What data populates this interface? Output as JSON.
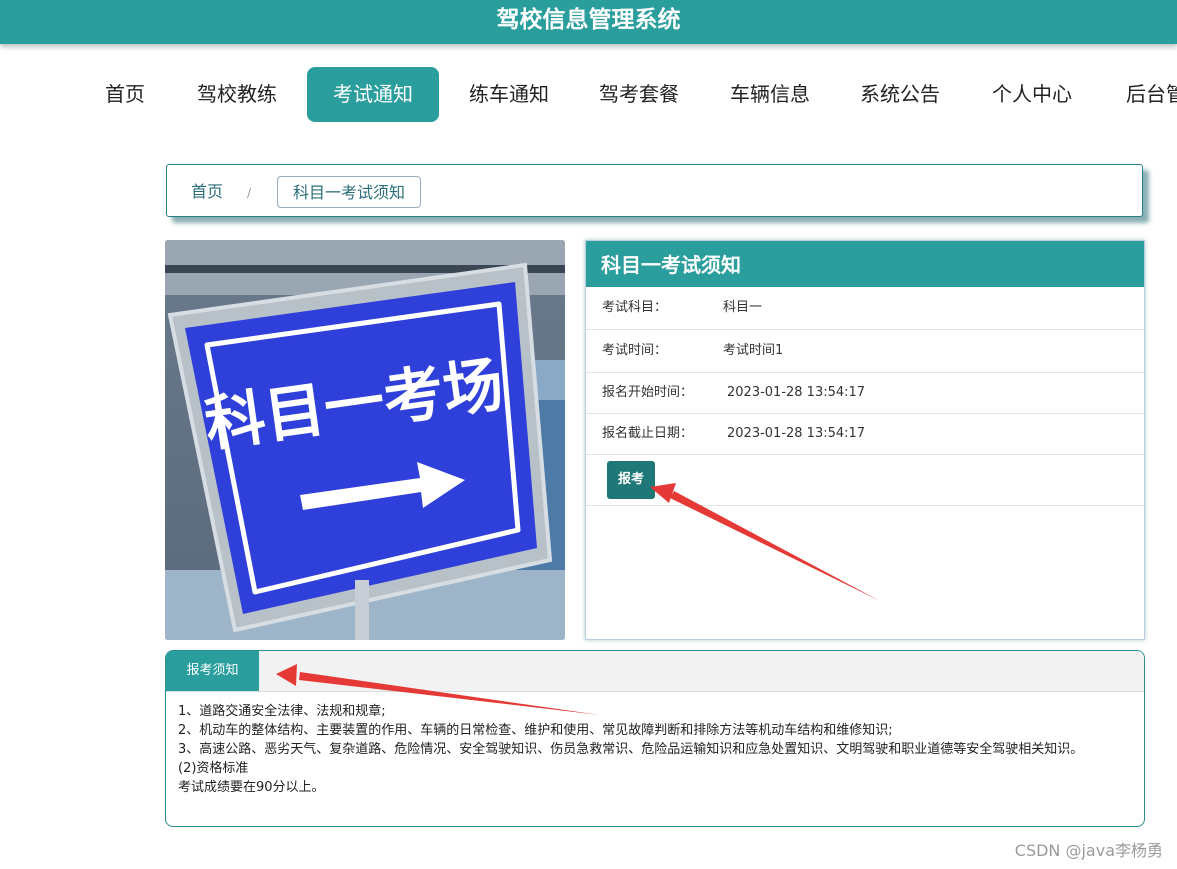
{
  "app": {
    "title": "驾校信息管理系统"
  },
  "nav": {
    "items": [
      {
        "id": "home",
        "label": "首页"
      },
      {
        "id": "coach",
        "label": "驾校教练"
      },
      {
        "id": "exam-notice",
        "label": "考试通知",
        "active": true
      },
      {
        "id": "practice-notice",
        "label": "练车通知"
      },
      {
        "id": "package",
        "label": "驾考套餐"
      },
      {
        "id": "vehicle",
        "label": "车辆信息"
      },
      {
        "id": "announcement",
        "label": "系统公告"
      },
      {
        "id": "profile",
        "label": "个人中心"
      },
      {
        "id": "admin",
        "label": "后台管"
      }
    ]
  },
  "breadcrumb": {
    "home": "首页",
    "sep": "/",
    "current": "科目一考试须知"
  },
  "photo": {
    "sign_text": "科目一考场"
  },
  "info": {
    "title": "科目一考试须知",
    "rows": [
      {
        "label": "考试科目：",
        "value": "科目一"
      },
      {
        "label": "考试时间：",
        "value": "考试时间1"
      },
      {
        "label": "报名开始时间：",
        "value": "2023-01-28 13:54:17"
      },
      {
        "label": "报名截止日期：",
        "value": "2023-01-28 13:54:17"
      }
    ],
    "signup_button": "报考"
  },
  "notice": {
    "tab": "报考须知",
    "lines": [
      "1、道路交通安全法律、法规和规章;",
      "2、机动车的整体结构、主要装置的作用、车辆的日常检查、维护和使用、常见故障判断和排除方法等机动车结构和维修知识;",
      "3、高速公路、恶劣天气、复杂道路、危险情况、安全驾驶知识、伤员急救常识、危险品运输知识和应急处置知识、文明驾驶和职业道德等安全驾驶相关知识。",
      "(2)资格标准",
      "考试成绩要在90分以上。"
    ]
  },
  "watermark": "CSDN @java李杨勇",
  "colors": {
    "primary": "#2a9d9d",
    "button": "#1f7777",
    "arrow": "#e53935"
  }
}
